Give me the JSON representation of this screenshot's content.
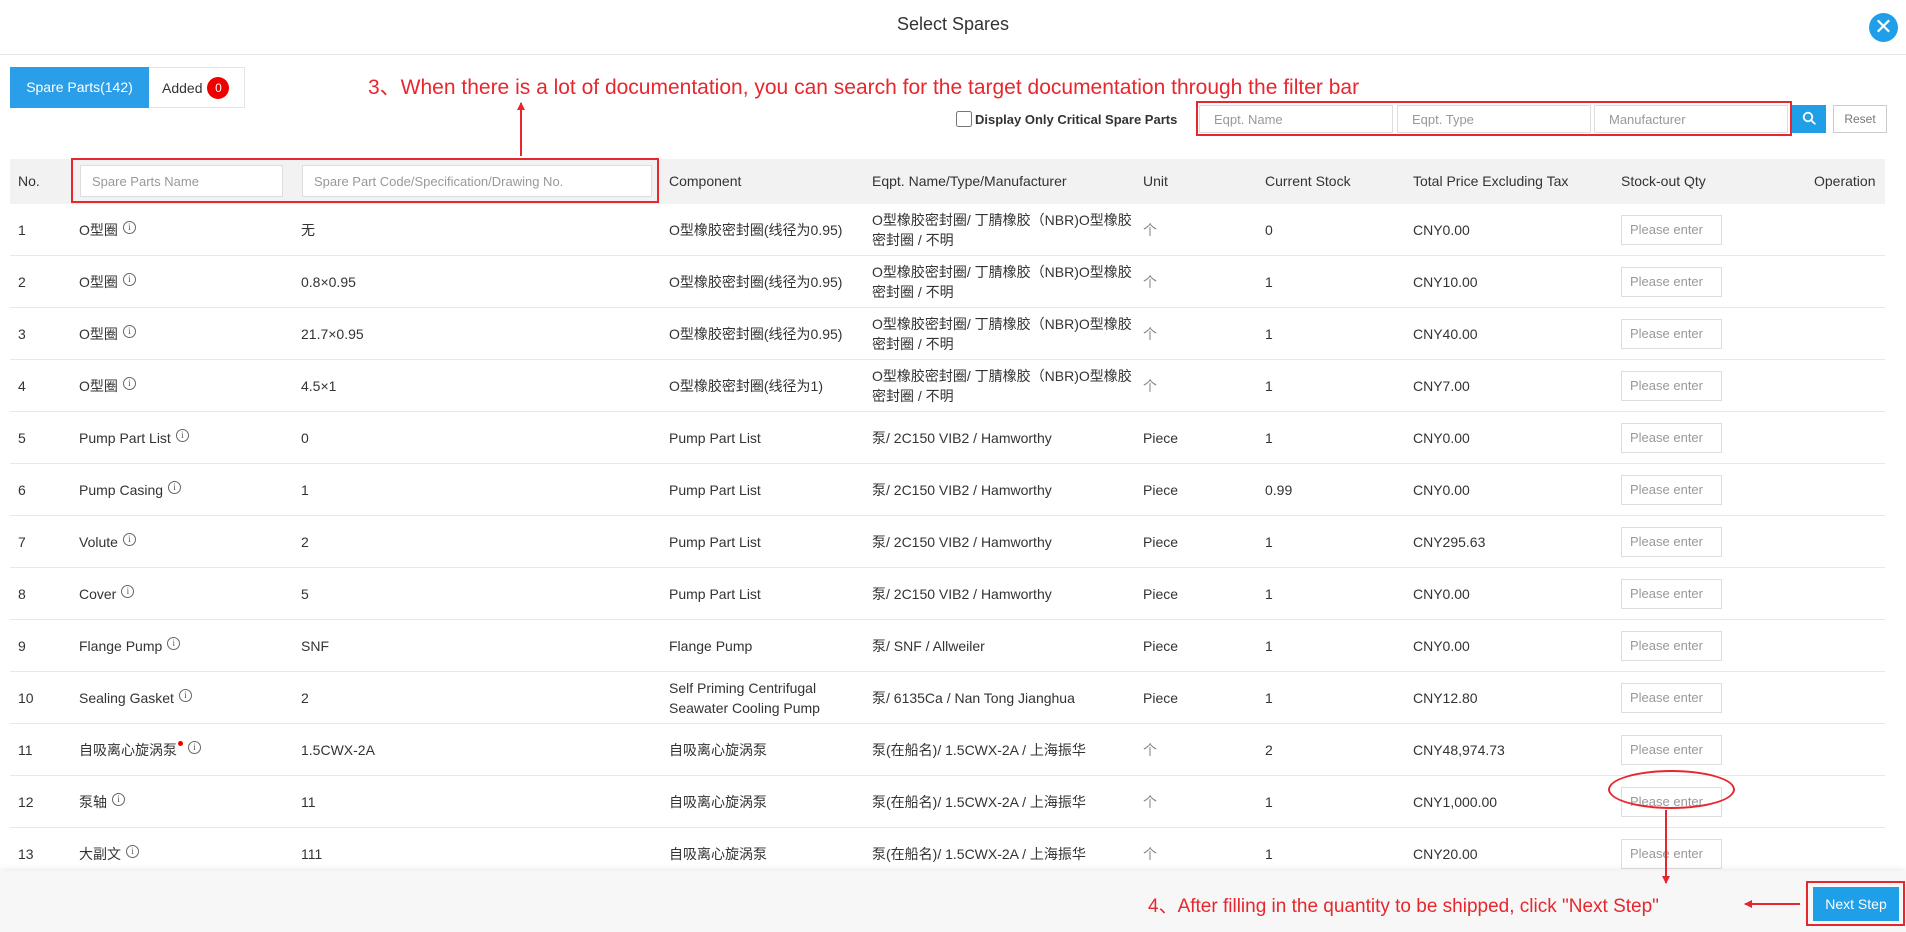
{
  "header": {
    "title": "Select Spares",
    "close_glyph": "✕"
  },
  "tabs": {
    "spare_parts": "Spare Parts(142)",
    "added": "Added",
    "added_count": "0"
  },
  "annotations": {
    "step3": "3、When there is a lot of documentation, you can search for the target documentation through the filter bar",
    "step4": "4、After filling in the quantity to be shipped, click \"Next Step\""
  },
  "filters": {
    "critical_label": "Display Only Critical Spare Parts",
    "eqpt_name_placeholder": "Eqpt. Name",
    "eqpt_type_placeholder": "Eqpt. Type",
    "manufacturer_placeholder": "Manufacturer",
    "search_icon": "search-icon",
    "reset_label": "Reset"
  },
  "table": {
    "columns": {
      "no": "No.",
      "name_placeholder": "Spare Parts Name",
      "code_placeholder": "Spare Part Code/Specification/Drawing No.",
      "component": "Component",
      "eqpt": "Eqpt. Name/Type/Manufacturer",
      "unit": "Unit",
      "stock": "Current Stock",
      "price": "Total Price Excluding Tax",
      "qty": "Stock-out Qty",
      "operation": "Operation"
    },
    "qty_placeholder": "Please enter",
    "rows": [
      {
        "no": "1",
        "name": "O型圈",
        "code": "无",
        "component": "O型橡胶密封圈(线径为0.95)",
        "eqpt": "O型橡胶密封圈/ 丁腈橡胶（NBR)O型橡胶密封圈 / 不明",
        "unit": "个",
        "stock": "0",
        "price": "CNY0.00",
        "critical": false
      },
      {
        "no": "2",
        "name": "O型圈",
        "code": "0.8×0.95",
        "component": "O型橡胶密封圈(线径为0.95)",
        "eqpt": "O型橡胶密封圈/ 丁腈橡胶（NBR)O型橡胶密封圈 / 不明",
        "unit": "个",
        "stock": "1",
        "price": "CNY10.00",
        "critical": false
      },
      {
        "no": "3",
        "name": "O型圈",
        "code": "21.7×0.95",
        "component": "O型橡胶密封圈(线径为0.95)",
        "eqpt": "O型橡胶密封圈/ 丁腈橡胶（NBR)O型橡胶密封圈 / 不明",
        "unit": "个",
        "stock": "1",
        "price": "CNY40.00",
        "critical": false
      },
      {
        "no": "4",
        "name": "O型圈",
        "code": "4.5×1",
        "component": "O型橡胶密封圈(线径为1)",
        "eqpt": "O型橡胶密封圈/ 丁腈橡胶（NBR)O型橡胶密封圈 / 不明",
        "unit": "个",
        "stock": "1",
        "price": "CNY7.00",
        "critical": false
      },
      {
        "no": "5",
        "name": "Pump Part List",
        "code": "0",
        "component": "Pump Part List",
        "eqpt": "泵/ 2C150 VIB2 / Hamworthy",
        "unit": "Piece",
        "stock": "1",
        "price": "CNY0.00",
        "critical": false
      },
      {
        "no": "6",
        "name": "Pump Casing",
        "code": "1",
        "component": "Pump Part List",
        "eqpt": "泵/ 2C150 VIB2 / Hamworthy",
        "unit": "Piece",
        "stock": "0.99",
        "price": "CNY0.00",
        "critical": false
      },
      {
        "no": "7",
        "name": "Volute",
        "code": "2",
        "component": "Pump Part List",
        "eqpt": "泵/ 2C150 VIB2 / Hamworthy",
        "unit": "Piece",
        "stock": "1",
        "price": "CNY295.63",
        "critical": false
      },
      {
        "no": "8",
        "name": "Cover",
        "code": "5",
        "component": "Pump Part List",
        "eqpt": "泵/ 2C150 VIB2 / Hamworthy",
        "unit": "Piece",
        "stock": "1",
        "price": "CNY0.00",
        "critical": false
      },
      {
        "no": "9",
        "name": "Flange Pump",
        "code": "SNF",
        "component": "Flange Pump",
        "eqpt": "泵/ SNF / Allweiler",
        "unit": "Piece",
        "stock": "1",
        "price": "CNY0.00",
        "critical": false
      },
      {
        "no": "10",
        "name": "Sealing Gasket",
        "code": "2",
        "component": "Self Priming Centrifugal Seawater Cooling Pump",
        "eqpt": "泵/ 6135Ca / Nan Tong Jianghua",
        "unit": "Piece",
        "stock": "1",
        "price": "CNY12.80",
        "critical": false
      },
      {
        "no": "11",
        "name": "自吸离心旋涡泵",
        "code": "1.5CWX-2A",
        "component": "自吸离心旋涡泵",
        "eqpt": "泵(在船名)/ 1.5CWX-2A / 上海振华",
        "unit": "个",
        "stock": "2",
        "price": "CNY48,974.73",
        "critical": true
      },
      {
        "no": "12",
        "name": "泵轴",
        "code": "11",
        "component": "自吸离心旋涡泵",
        "eqpt": "泵(在船名)/ 1.5CWX-2A / 上海振华",
        "unit": "个",
        "stock": "1",
        "price": "CNY1,000.00",
        "critical": false
      },
      {
        "no": "13",
        "name": "大副文",
        "code": "111",
        "component": "自吸离心旋涡泵",
        "eqpt": "泵(在船名)/ 1.5CWX-2A / 上海振华",
        "unit": "个",
        "stock": "1",
        "price": "CNY20.00",
        "critical": false
      }
    ]
  },
  "footer": {
    "next_label": "Next Step"
  },
  "colors": {
    "primary": "#1e9fe8",
    "annotation_red": "#e7272e",
    "badge_red": "#e00000"
  }
}
